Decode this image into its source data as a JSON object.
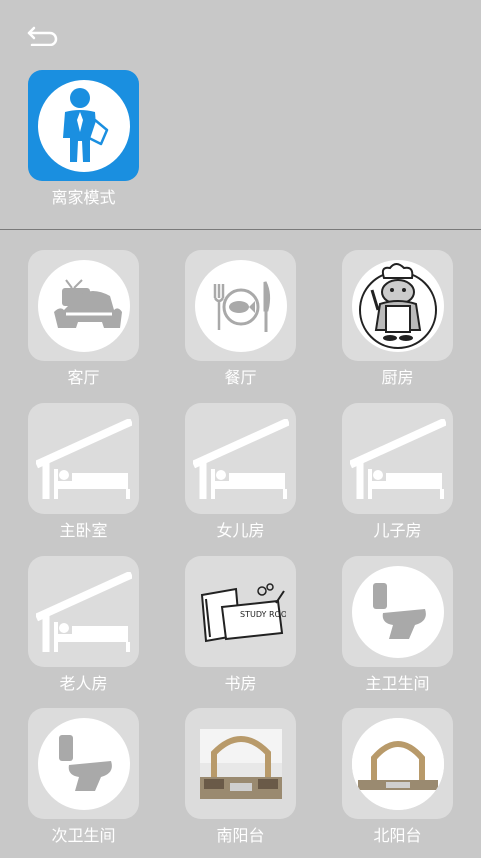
{
  "header": {
    "back_icon": "back-arrow-icon"
  },
  "mode": {
    "label": "离家模式",
    "icon": "leaving-home-person-icon",
    "color": "#1a8fe0"
  },
  "rooms": [
    {
      "label": "客厅",
      "icon": "sofa-tv-icon"
    },
    {
      "label": "餐厅",
      "icon": "dining-plate-icon"
    },
    {
      "label": "厨房",
      "icon": "chef-icon"
    },
    {
      "label": "主卧室",
      "icon": "bed-house-icon"
    },
    {
      "label": "女儿房",
      "icon": "bed-house-icon"
    },
    {
      "label": "儿子房",
      "icon": "bed-house-icon"
    },
    {
      "label": "老人房",
      "icon": "bed-house-icon"
    },
    {
      "label": "书房",
      "icon": "study-books-icon",
      "text": "STUDY ROOM"
    },
    {
      "label": "主卫生间",
      "icon": "toilet-icon"
    },
    {
      "label": "次卫生间",
      "icon": "toilet-icon"
    },
    {
      "label": "南阳台",
      "icon": "balcony-photo-icon"
    },
    {
      "label": "北阳台",
      "icon": "balcony-photo-icon"
    }
  ],
  "colors": {
    "background": "#c8c8c8",
    "tile": "#dcdcdc",
    "icon_gray": "#a9a9a9",
    "text": "#ffffff"
  }
}
